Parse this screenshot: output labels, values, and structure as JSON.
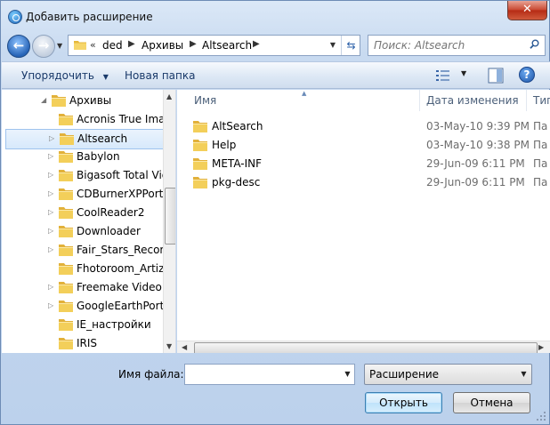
{
  "window": {
    "title": "Добавить расширение",
    "close_label": "✕"
  },
  "nav": {
    "back_label": "←",
    "forward_label": "→"
  },
  "address": {
    "overflow": "«",
    "crumbs": [
      "ded",
      "Архивы",
      "Altsearch"
    ]
  },
  "search": {
    "placeholder": "Поиск: Altsearch"
  },
  "toolbar": {
    "organize_label": "Упорядочить",
    "new_folder_label": "Новая папка",
    "help_label": "?"
  },
  "tree": {
    "items": [
      {
        "label": "Архивы",
        "expanded": true,
        "level": 0
      },
      {
        "label": "Acronis True Imag",
        "level": 1
      },
      {
        "label": "Altsearch",
        "level": 1,
        "selected": true
      },
      {
        "label": "Babylon",
        "level": 1
      },
      {
        "label": "Bigasoft Total Vid",
        "level": 1
      },
      {
        "label": "CDBurnerXPPorta",
        "level": 1
      },
      {
        "label": "CoolReader2",
        "level": 1
      },
      {
        "label": "Downloader",
        "level": 1
      },
      {
        "label": "Fair_Stars_Recorde",
        "level": 1
      },
      {
        "label": "Fhotoroom_Artize",
        "level": 1
      },
      {
        "label": "Freemake Video C",
        "level": 1
      },
      {
        "label": "GoogleEarthPorta",
        "level": 1
      },
      {
        "label": "IE_настройки",
        "level": 1
      },
      {
        "label": "IRIS",
        "level": 1
      }
    ]
  },
  "files": {
    "columns": {
      "name": "Имя",
      "date": "Дата изменения",
      "type": "Тип"
    },
    "rows": [
      {
        "name": "AltSearch",
        "date": "03-May-10 9:39 PM",
        "type": "Па"
      },
      {
        "name": "Help",
        "date": "03-May-10 9:38 PM",
        "type": "Па"
      },
      {
        "name": "META-INF",
        "date": "29-Jun-09 6:11 PM",
        "type": "Па"
      },
      {
        "name": "pkg-desc",
        "date": "29-Jun-09 6:11 PM",
        "type": "Па"
      }
    ]
  },
  "bottom": {
    "filename_label": "Имя файла:",
    "filename_value": "",
    "filter_value": "Расширение",
    "open_label": "Открыть",
    "cancel_label": "Отмена"
  },
  "colors": {
    "folder_yellow": "#f3cf5a",
    "selection": "#d7e9fb",
    "accent_blue": "#2764b7"
  }
}
